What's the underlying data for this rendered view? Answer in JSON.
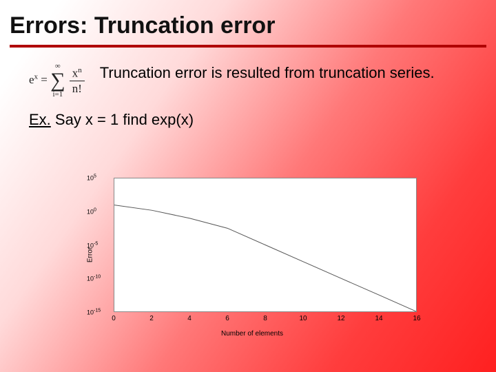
{
  "title": "Errors: Truncation error",
  "formula": {
    "lhs": "e",
    "lhs_sup": "x",
    "eq": "=",
    "sum_top": "∞",
    "sum_bot": "i=1",
    "frac_num_base": "x",
    "frac_num_sup": "n",
    "frac_den": "n!"
  },
  "description": "Truncation error is resulted from truncation series.",
  "example_label": "Ex.",
  "example_text": " Say x = 1  find exp(x)",
  "chart_data": {
    "type": "line",
    "title": "",
    "xlabel": "Number of elements",
    "ylabel": "Error",
    "xlim": [
      0,
      16
    ],
    "ylim_log10": [
      -15,
      5
    ],
    "xticks": [
      0,
      2,
      4,
      6,
      8,
      10,
      12,
      14,
      16
    ],
    "ytick_exponents": [
      5,
      0,
      -5,
      -10,
      -15
    ],
    "x": [
      0,
      2,
      4,
      6,
      8,
      10,
      12,
      14,
      16
    ],
    "log10_y": [
      1,
      0.2,
      -1,
      -2.5,
      -5,
      -7.5,
      -10,
      -12.5,
      -15
    ]
  }
}
